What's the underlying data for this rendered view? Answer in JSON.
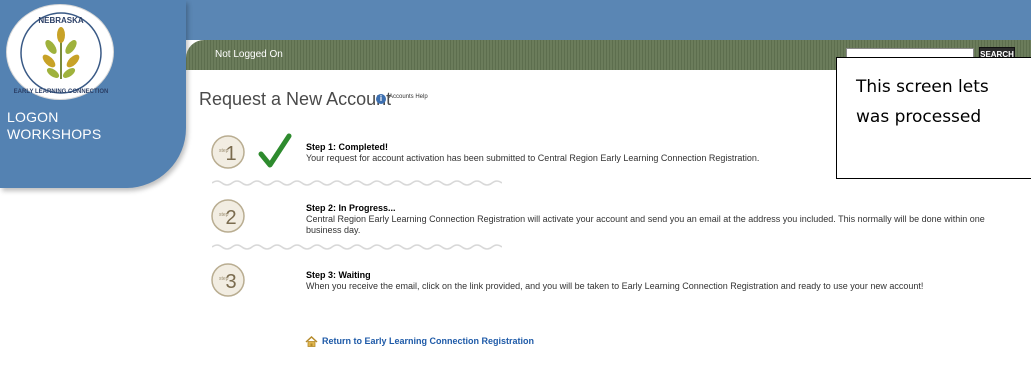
{
  "sidebar": {
    "logo_alt": "NEBRASKA EARLY LEARNING CONNECTION",
    "items": [
      {
        "label": "LOGON"
      },
      {
        "label": "WORKSHOPS"
      }
    ]
  },
  "header": {
    "status": "Not Logged On",
    "search_placeholder": "",
    "search_button": "SEARCH"
  },
  "page": {
    "title": "Request a New Account",
    "help_link": "Accounts Help"
  },
  "callout": {
    "line1": "This screen lets",
    "line2": "was processed"
  },
  "steps": [
    {
      "badge_word": "step",
      "number": "1",
      "heading": "Step 1: Completed!",
      "description": "Your request for account activation has been submitted to Central Region Early Learning Connection Registration."
    },
    {
      "badge_word": "step",
      "number": "2",
      "heading": "Step 2: In Progress...",
      "description": "Central Region Early Learning Connection Registration will activate your account and send you an email at the address you included. This normally will be done within one business day."
    },
    {
      "badge_word": "step",
      "number": "3",
      "heading": "Step 3: Waiting",
      "description": "When you receive the email, click on the link provided, and you will be taken to Early Learning Connection Registration and ready to use your new account!"
    }
  ],
  "return_link": "Return to Early Learning Connection Registration",
  "colors": {
    "sidebar_blue": "#5482b2",
    "navbar_olive": "#6b7c5b",
    "check_green": "#2e8b2e",
    "link_blue": "#1e5aa8"
  }
}
